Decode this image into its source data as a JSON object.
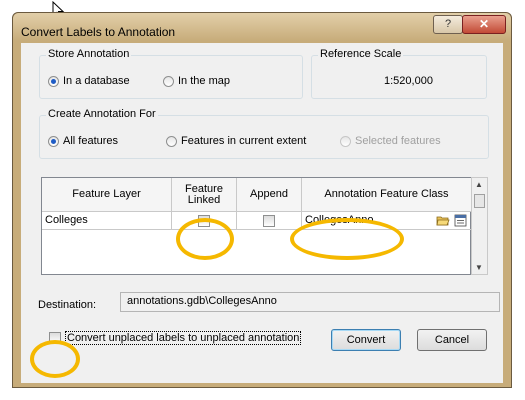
{
  "dialog": {
    "title": "Convert Labels to Annotation",
    "help_label": "?",
    "close_label": "✕"
  },
  "store_annotation": {
    "label": "Store Annotation",
    "options": [
      {
        "label": "In a database",
        "selected": true
      },
      {
        "label": "In the map",
        "selected": false
      }
    ]
  },
  "reference_scale": {
    "label": "Reference Scale",
    "value": "1:520,000"
  },
  "create_for": {
    "label": "Create Annotation For",
    "options": [
      {
        "label": "All features",
        "selected": true,
        "enabled": true
      },
      {
        "label": "Features in current extent",
        "selected": false,
        "enabled": true
      },
      {
        "label": "Selected features",
        "selected": false,
        "enabled": false
      }
    ]
  },
  "table": {
    "columns": [
      "Feature Layer",
      "Feature Linked",
      "Append",
      "Annotation Feature Class"
    ],
    "rows": [
      {
        "feature_layer": "Colleges",
        "feature_linked": false,
        "append": false,
        "annotation_class": "CollegesAnno"
      }
    ]
  },
  "destination": {
    "label": "Destination:",
    "value": "annotations.gdb\\CollegesAnno"
  },
  "unplaced": {
    "label": "Convert unplaced labels to unplaced annotation",
    "checked": false
  },
  "buttons": {
    "convert": "Convert",
    "cancel": "Cancel"
  },
  "icons": [
    "cursor-arrow-icon",
    "open-folder-icon",
    "properties-icon",
    "scroll-up-icon",
    "scroll-down-icon"
  ],
  "colors": {
    "highlight_ring": "#f5b800",
    "radio_selected": "#1f5cc5",
    "frame": "#c7ac7a"
  }
}
